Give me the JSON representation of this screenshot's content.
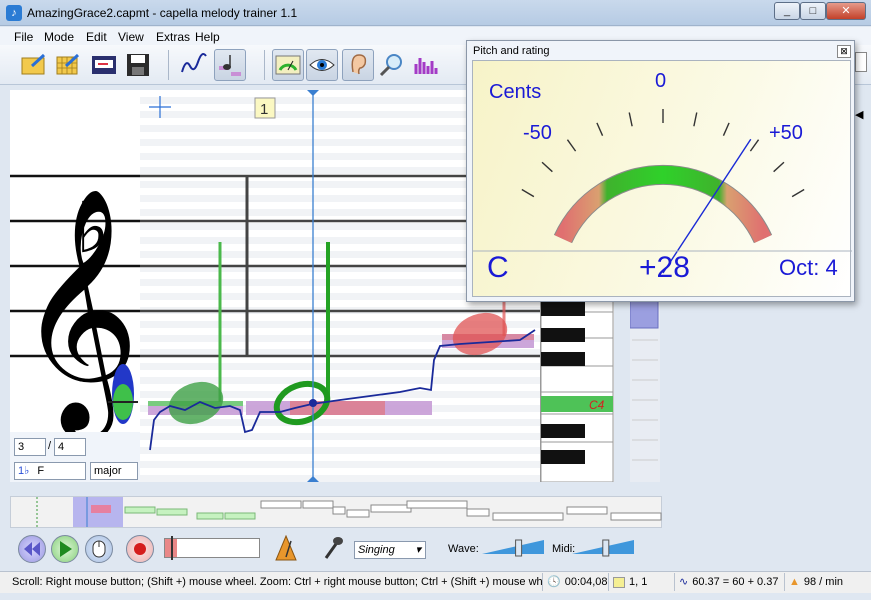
{
  "window": {
    "title": "AmazingGrace2.capmt - capella melody trainer 1.1",
    "minimize": "_",
    "maximize": "□",
    "close": "✕"
  },
  "menu": [
    "File",
    "Mode",
    "Edit",
    "View",
    "Extras",
    "Help"
  ],
  "toolbar": {
    "icons": [
      "open-folder-icon",
      "open-grid-icon",
      "import-icon",
      "save-icon",
      "pitch-curve-icon",
      "notes-icon",
      "meter-icon",
      "eye-icon",
      "ear-icon",
      "magnifier-icon",
      "bar-chart-icon"
    ]
  },
  "score": {
    "measure_number": "1",
    "key_label": "C4",
    "time_numerator": "3",
    "time_denominator": "4",
    "key_signature": "F",
    "mode": "major"
  },
  "transport": {
    "voice_option": "Singing",
    "wave_label": "Wave:",
    "midi_label": "Midi:",
    "wave_level": 0.6,
    "midi_level": 0.55
  },
  "status": {
    "hint": "Scroll: Right mouse button; (Shift +) mouse wheel.  Zoom: Ctrl + right mouse button; Ctrl + (Shift +) mouse whe",
    "time": "00:04,08",
    "position": "1, 1",
    "pitch": "60.37 = 60 + 0.37",
    "tempo": "98 / min"
  },
  "pitch_dialog": {
    "title": "Pitch and rating",
    "close": "⊠",
    "units_label": "Cents",
    "scale_min": "-50",
    "scale_zero": "0",
    "scale_max": "+50",
    "note": "C",
    "deviation": "+28",
    "octave": "Oct: 4",
    "cents_value": 28
  },
  "colors": {
    "gauge_green": "#2db22d",
    "gauge_red": "#e07070",
    "text_blue": "#1a1ad6",
    "pitch_curve": "#1a2a9a"
  }
}
